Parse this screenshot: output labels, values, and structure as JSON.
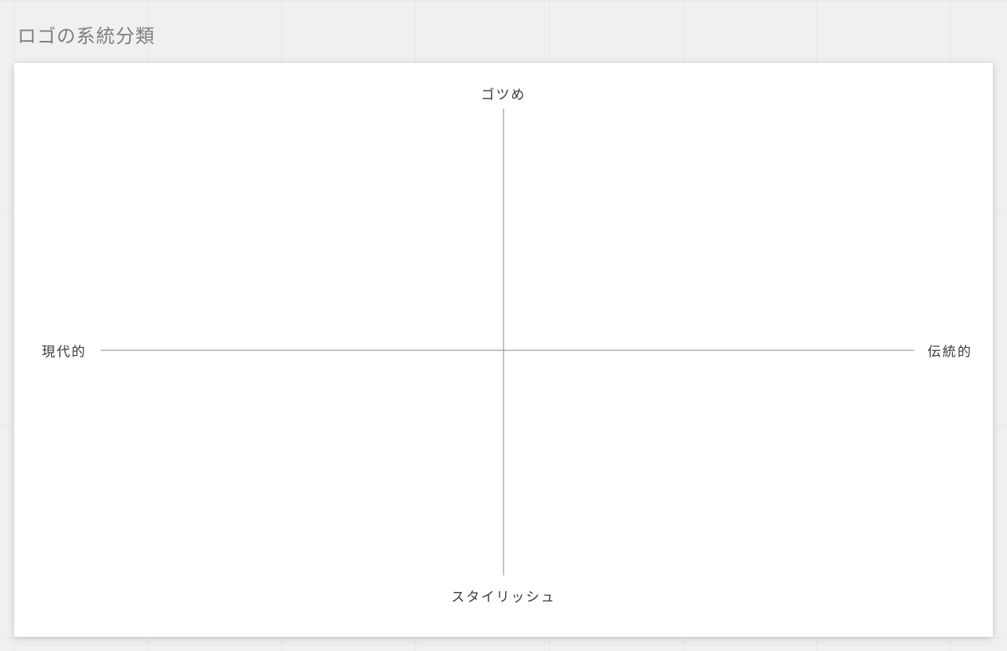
{
  "title": "ロゴの系統分類",
  "quadrant": {
    "top": "ゴツめ",
    "bottom": "スタイリッシュ",
    "left": "現代的",
    "right": "伝統的"
  }
}
